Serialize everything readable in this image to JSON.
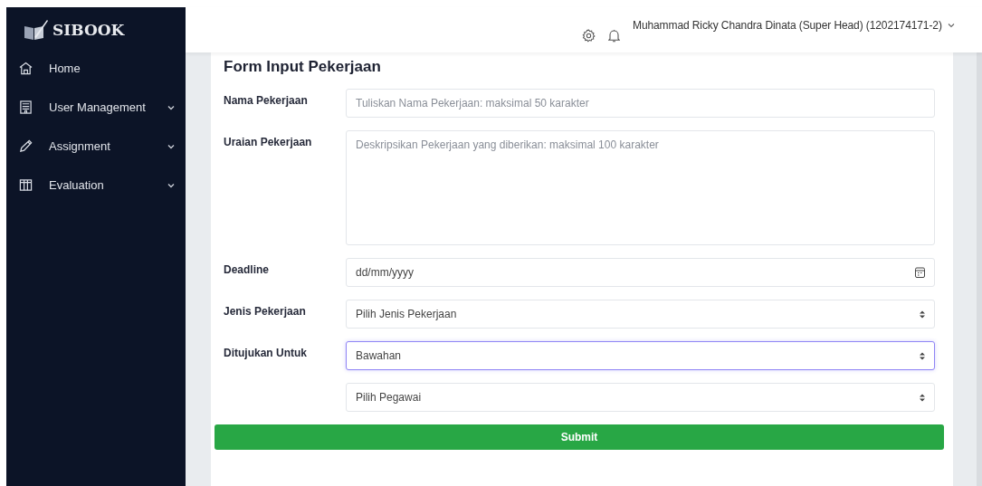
{
  "sidebar": {
    "logo": "SIBOOK",
    "items": [
      {
        "label": "Home",
        "kind": "home",
        "has_submenu": false
      },
      {
        "label": "User Management",
        "kind": "building",
        "has_submenu": true
      },
      {
        "label": "Assignment",
        "kind": "pencil",
        "has_submenu": true
      },
      {
        "label": "Evaluation",
        "kind": "table",
        "has_submenu": true
      }
    ]
  },
  "header": {
    "user": "Muhammad Ricky Chandra Dinata (Super Head) (1202174171-2)"
  },
  "form": {
    "title": "Form Input Pekerjaan",
    "fields": [
      {
        "kind": "text",
        "label": "Nama Pekerjaan",
        "placeholder": "Tuliskan Nama Pekerjaan: maksimal 50 karakter",
        "focused": false
      },
      {
        "kind": "textarea",
        "label": "Uraian Pekerjaan",
        "placeholder": "Deskripsikan Pekerjaan yang diberikan: maksimal 100 karakter",
        "focused": false
      },
      {
        "kind": "date",
        "label": "Deadline",
        "value": "dd/mm/yyyy",
        "focused": false
      },
      {
        "kind": "select",
        "label": "Jenis Pekerjaan",
        "value": "Pilih Jenis Pekerjaan",
        "focused": false
      },
      {
        "kind": "select",
        "label": "Ditujukan Untuk",
        "value": "Bawahan",
        "focused": true
      },
      {
        "kind": "select",
        "value": "Pilih Pegawai",
        "focused": false
      }
    ],
    "submit": "Submit"
  }
}
